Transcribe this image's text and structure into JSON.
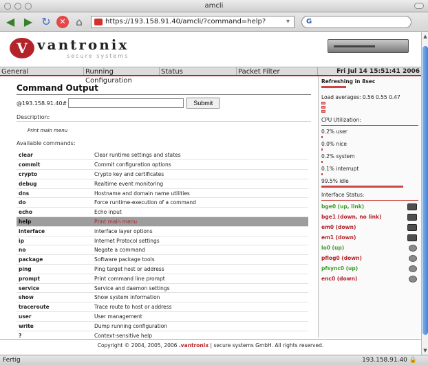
{
  "browser": {
    "title": "amcli",
    "url": "https://193.158.91.40/amcli/?command=help?",
    "search_placeholder": "G",
    "status_left": "Fertig",
    "status_right": "193.158.91.40"
  },
  "brand": {
    "name": "vantronix",
    "tagline": "secure systems"
  },
  "nav": {
    "tabs": [
      "General",
      "Running Configuration",
      "Status",
      "Packet Filter"
    ],
    "date": "Fri Jul 14 15:51:41 2006"
  },
  "main": {
    "title": "Command Output",
    "prompt": "@193.158.91.40#",
    "submit": "Submit",
    "description_label": "Description:",
    "description": "Print main menu",
    "available_label": "Available commands:",
    "commands": [
      {
        "cmd": "clear",
        "desc": "Clear runtime settings and states"
      },
      {
        "cmd": "commit",
        "desc": "Commit configuration options"
      },
      {
        "cmd": "crypto",
        "desc": "Crypto key and certificates"
      },
      {
        "cmd": "debug",
        "desc": "Realtime event monitoring"
      },
      {
        "cmd": "dns",
        "desc": "Hostname and domain name utilities"
      },
      {
        "cmd": "do",
        "desc": "Force runtime-execution of a command"
      },
      {
        "cmd": "echo",
        "desc": "Echo input"
      },
      {
        "cmd": "help",
        "desc": "Print main menu",
        "highlight": true
      },
      {
        "cmd": "interface",
        "desc": "interface layer options"
      },
      {
        "cmd": "ip",
        "desc": "Internet Protocol settings"
      },
      {
        "cmd": "no",
        "desc": "Negate a command"
      },
      {
        "cmd": "package",
        "desc": "Software package tools"
      },
      {
        "cmd": "ping",
        "desc": "Ping target host or address"
      },
      {
        "cmd": "prompt",
        "desc": "Print command line prompt"
      },
      {
        "cmd": "service",
        "desc": "Service and daemon settings"
      },
      {
        "cmd": "show",
        "desc": "Show system information"
      },
      {
        "cmd": "traceroute",
        "desc": "Trace route to host or address"
      },
      {
        "cmd": "user",
        "desc": "User management"
      },
      {
        "cmd": "write",
        "desc": "Dump running configuration"
      },
      {
        "cmd": "?",
        "desc": "Context-sensitive help"
      }
    ]
  },
  "side": {
    "refresh": "Refreshing in 8sec",
    "load": "Load averages: 0.56 0.55 0.47",
    "cpu_title": "CPU Utilization:",
    "cpu": [
      "0.2% user",
      "0.0% nice",
      "0.2% system",
      "0.1% interrupt",
      "99.5% idle"
    ],
    "cpu_values": [
      0.002,
      0.0,
      0.002,
      0.001,
      0.995
    ],
    "iface_title": "Interface Status:",
    "interfaces": [
      {
        "name": "bge0 (up, link)",
        "state": "up",
        "icon": "ethernet-icon"
      },
      {
        "name": "bge1 (down, no link)",
        "state": "down",
        "icon": "ethernet-icon"
      },
      {
        "name": "em0 (down)",
        "state": "down",
        "icon": "ethernet-icon"
      },
      {
        "name": "em1 (down)",
        "state": "down",
        "icon": "ethernet-icon"
      },
      {
        "name": "lo0 (up)",
        "state": "up",
        "icon": "loopback-icon"
      },
      {
        "name": "pflog0 (down)",
        "state": "down",
        "icon": "loopback-icon"
      },
      {
        "name": "pfsync0 (up)",
        "state": "up",
        "icon": "loopback-icon"
      },
      {
        "name": "enc0 (down)",
        "state": "down",
        "icon": "loopback-icon"
      }
    ]
  },
  "footer": {
    "pre": "Copyright © 2004, 2005, 2006 ",
    "brand": ".vantronix",
    "post": " | secure systems GmbH. All rights reserved."
  },
  "colors": {
    "accent": "#b4232a",
    "up": "#3d9a2a",
    "highlight_row": "#9d9d9d"
  }
}
